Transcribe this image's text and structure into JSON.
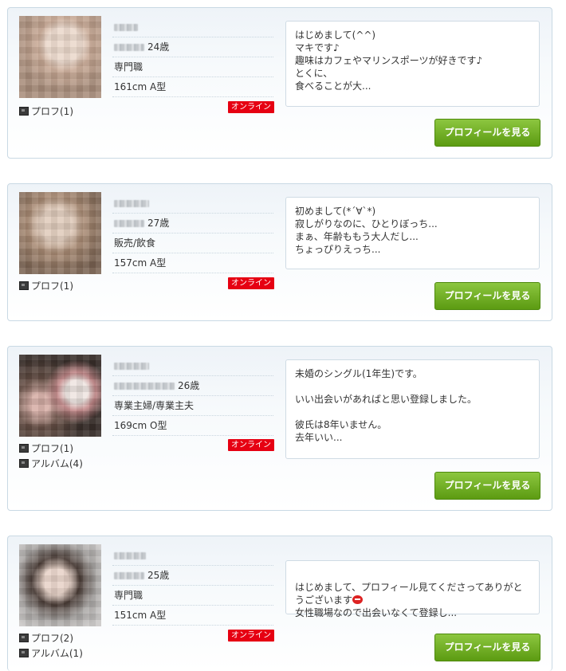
{
  "profiles": [
    {
      "age": "24歳",
      "job": "専門職",
      "stats": "161cm  A型",
      "online": "オンライン",
      "prof_link": "プロフ(1)",
      "album_link": "",
      "message": "はじめまして(^^)\nマキです♪\n趣味はカフェやマリンスポーツが好きです♪\nとくに、\n食べることが大...",
      "button": "プロフィールを見る"
    },
    {
      "age": "27歳",
      "job": "販売/飲食",
      "stats": "157cm  A型",
      "online": "オンライン",
      "prof_link": "プロフ(1)",
      "album_link": "",
      "message": "初めまして(*´∀`*)\n寂しがりなのに、ひとりぼっち...\nまぁ、年齢ももう大人だし...\nちょっぴりえっち...",
      "button": "プロフィールを見る"
    },
    {
      "age": "26歳",
      "job": "専業主婦/専業主夫",
      "stats": "169cm  O型",
      "online": "オンライン",
      "prof_link": "プロフ(1)",
      "album_link": "アルバム(4)",
      "message": "未婚のシングル(1年生)です。\n\nいい出会いがあればと思い登録しました。\n\n彼氏は8年いません。\n去年いい...",
      "button": "プロフィールを見る"
    },
    {
      "age": "25歳",
      "job": "専門職",
      "stats": "151cm  A型",
      "online": "オンライン",
      "prof_link": "プロフ(2)",
      "album_link": "アルバム(1)",
      "message_a": "はじめまして、プロフィール見てくださってありがと\nうございます",
      "message_b": "\n女性職場なので出会いなくて登録し...",
      "button": "プロフィールを見る"
    }
  ],
  "icons": {
    "photo_link": "photo-icon",
    "emoji": "emoji-icon"
  },
  "colors": {
    "online_badge": "#e60012",
    "button": "#6aa820",
    "border": "#c9d9e4"
  }
}
